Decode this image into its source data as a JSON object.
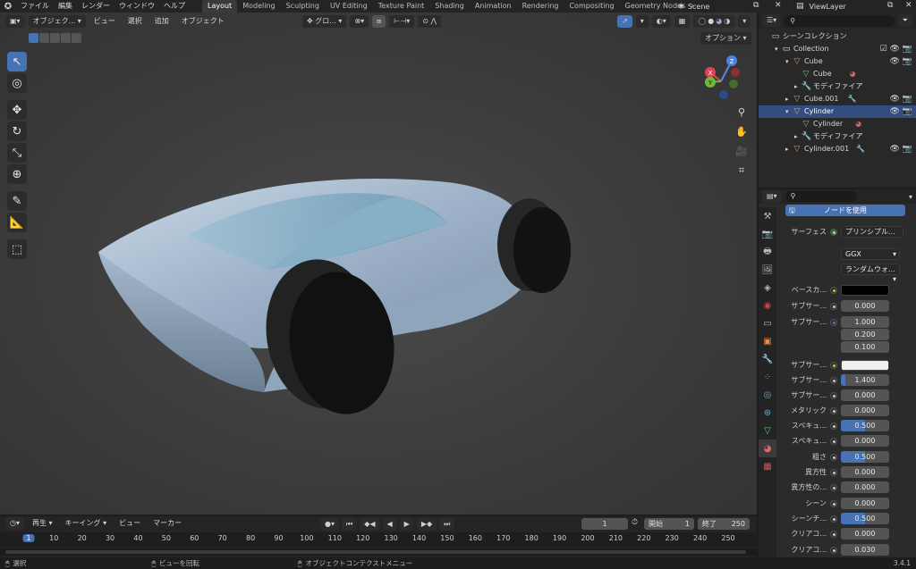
{
  "topbar": {
    "menus": [
      "ファイル",
      "編集",
      "レンダー",
      "ウィンドウ",
      "ヘルプ"
    ],
    "workspaces": [
      "Layout",
      "Modeling",
      "Sculpting",
      "UV Editing",
      "Texture Paint",
      "Shading",
      "Animation",
      "Rendering",
      "Compositing",
      "Geometry Nodes"
    ],
    "active_workspace": "Layout",
    "scene": "Scene",
    "view_layer": "ViewLayer"
  },
  "viewport": {
    "mode": "オブジェク...",
    "menus": [
      "ビュー",
      "選択",
      "追加",
      "オブジェクト"
    ],
    "transform_orientation": "グロ...",
    "options_label": "オプション",
    "axes": {
      "x": "X",
      "y": "Y",
      "z": "Z"
    }
  },
  "outliner": {
    "root": "シーンコレクション",
    "items": [
      {
        "label": "Collection",
        "level": 0
      },
      {
        "label": "Cube",
        "level": 1
      },
      {
        "label": "Cube",
        "level": 2
      },
      {
        "label": "モディファイア",
        "level": 2
      },
      {
        "label": "Cube.001",
        "level": 1
      },
      {
        "label": "Cylinder",
        "level": 1
      },
      {
        "label": "Cylinder",
        "level": 2
      },
      {
        "label": "モディファイア",
        "level": 2
      },
      {
        "label": "Cylinder.001",
        "level": 1
      }
    ]
  },
  "properties": {
    "use_nodes_button": "ノードを使用",
    "surface_label": "サーフェス",
    "surface_value": "プリンシプル...",
    "distribution": "GGX",
    "subsurface_method": "ランダムウォ...",
    "rows": [
      {
        "label": "ベースカ...",
        "kind": "color",
        "color": "#000000"
      },
      {
        "label": "サブサー...",
        "value": "0.000",
        "fill": 0
      },
      {
        "label": "サブサー...",
        "value": "1.000",
        "fill": 0
      },
      {
        "label": "",
        "value": "0.200",
        "fill": 0
      },
      {
        "label": "",
        "value": "0.100",
        "fill": 0
      },
      {
        "label": "サブサー...",
        "kind": "color",
        "color": "#f0f0f0"
      },
      {
        "label": "サブサー...",
        "value": "1.400",
        "fill": 0.1
      },
      {
        "label": "サブサー...",
        "value": "0.000",
        "fill": 0
      },
      {
        "label": "メタリック",
        "value": "0.000",
        "fill": 0
      },
      {
        "label": "スペキュ...",
        "value": "0.500",
        "fill": 0.5
      },
      {
        "label": "スペキュ...",
        "value": "0.000",
        "fill": 0
      },
      {
        "label": "粗さ",
        "value": "0.500",
        "fill": 0.5
      },
      {
        "label": "異方性",
        "value": "0.000",
        "fill": 0
      },
      {
        "label": "異方性の...",
        "value": "0.000",
        "fill": 0
      },
      {
        "label": "シーン",
        "value": "0.000",
        "fill": 0
      },
      {
        "label": "シーンチ...",
        "value": "0.500",
        "fill": 0.5
      },
      {
        "label": "クリアコ...",
        "value": "0.000",
        "fill": 0
      },
      {
        "label": "クリアコ...",
        "value": "0.030",
        "fill": 0
      }
    ]
  },
  "timeline": {
    "menus": [
      "再生",
      "キーイング",
      "ビュー",
      "マーカー"
    ],
    "current_frame": "1",
    "start_label": "開始",
    "start": "1",
    "end_label": "終了",
    "end": "250",
    "ticks": [
      "1",
      "10",
      "20",
      "30",
      "40",
      "50",
      "60",
      "70",
      "80",
      "90",
      "100",
      "110",
      "120",
      "130",
      "140",
      "150",
      "160",
      "170",
      "180",
      "190",
      "200",
      "210",
      "220",
      "230",
      "240",
      "250"
    ]
  },
  "statusbar": {
    "select": "選択",
    "rotate": "ビューを回転",
    "context": "オブジェクトコンテクストメニュー",
    "version": "3.4.1"
  }
}
